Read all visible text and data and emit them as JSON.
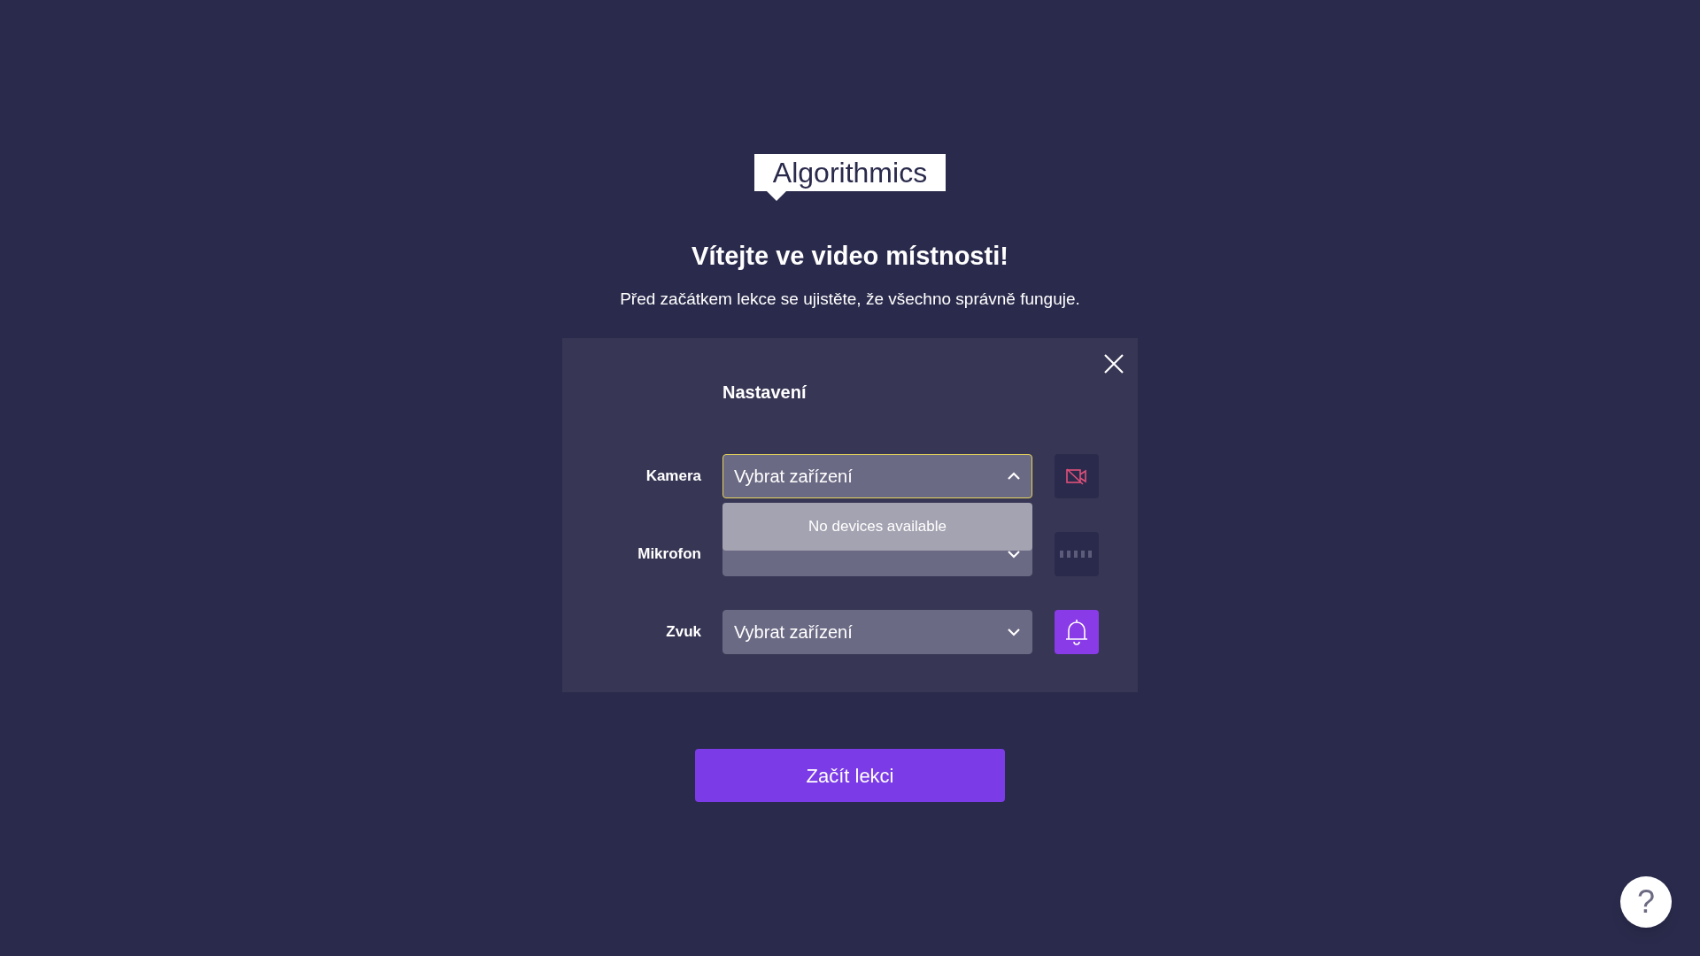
{
  "logo": {
    "text": "Algorithmics"
  },
  "heading": "Vítejte ve video místnosti!",
  "subtitle": "Před začátkem lekce se ujistěte, že všechno správně funguje.",
  "settings": {
    "title": "Nastavení",
    "rows": [
      {
        "label": "Kamera",
        "value": "Vybrat zařízení",
        "expanded": true,
        "kind": "camera"
      },
      {
        "label": "Mikrofon",
        "expanded": false,
        "kind": "meter"
      },
      {
        "label": "Zvuk",
        "value": "Vybrat zařízení",
        "expanded": false,
        "kind": "bell"
      }
    ],
    "dropdown": {
      "message": "No devices available"
    }
  },
  "start_button": "Začít lekci",
  "help_button": "?"
}
